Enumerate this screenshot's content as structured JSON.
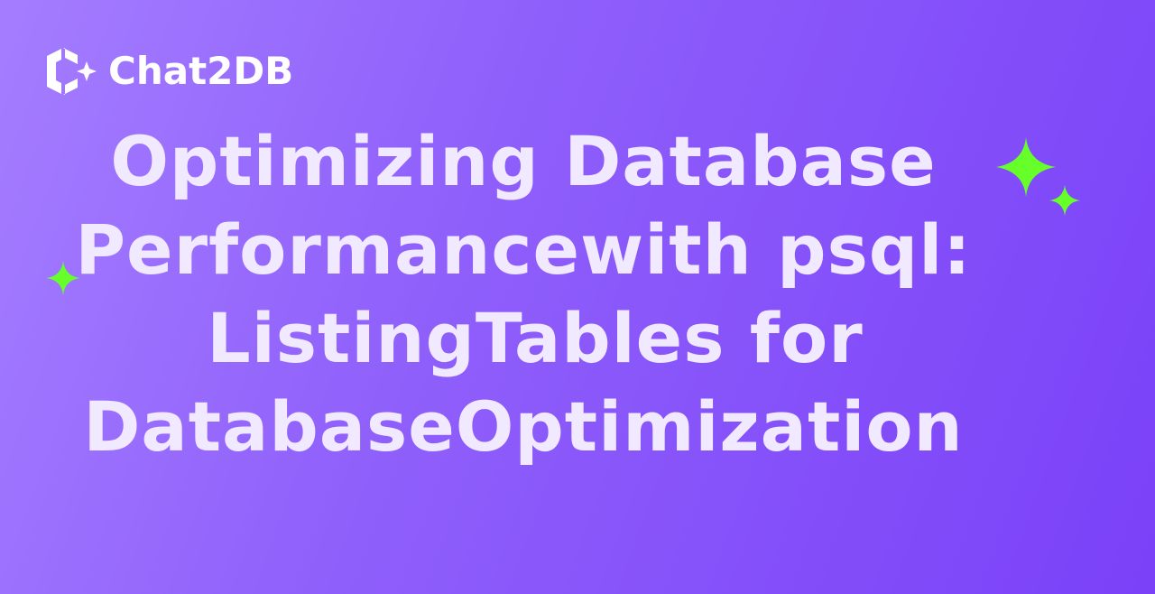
{
  "brand": {
    "name": "Chat2DB",
    "icon": "chat2db-logo-icon"
  },
  "title": {
    "lines": [
      "Optimizing Database",
      "Performancewith psql:",
      "ListingTables for",
      "DatabaseOptimization"
    ]
  },
  "decorations": {
    "sparkle_icon": "sparkle-icon",
    "sparkle_color": "#66ff2a"
  },
  "colors": {
    "background_start": "#a47dff",
    "background_end": "#7a41f8",
    "title_text": "#f0e9ff",
    "logo_text": "#ffffff"
  }
}
